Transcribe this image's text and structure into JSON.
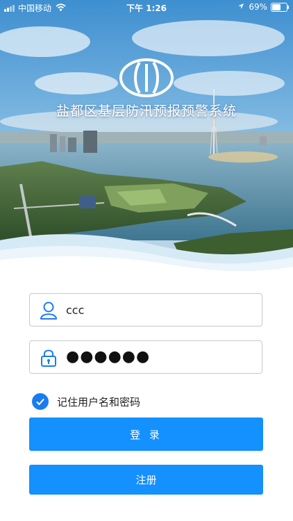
{
  "status_bar": {
    "carrier": "中国移动",
    "time": "下午 1:26",
    "battery_percent": "69%",
    "battery_level": 0.69,
    "icons": [
      "signal-icon",
      "wifi-icon",
      "location-arrow-icon",
      "battery-icon"
    ]
  },
  "header": {
    "title": "盐都区基层防汛预报预警系统",
    "logo": "flood-control-logo-icon"
  },
  "login_form": {
    "username_value": "ccc",
    "password_mask": "●●●●●●",
    "username_icon": "user-icon",
    "password_icon": "lock-icon",
    "remember_label": "记住用户名和密码",
    "remember_checked": true,
    "login_label": "登 录",
    "register_label": "注册"
  },
  "colors": {
    "primary": "#1490ff",
    "checkbox": "#1b7cf0",
    "icon": "#1b7cf0",
    "border": "#c8c8c8"
  }
}
